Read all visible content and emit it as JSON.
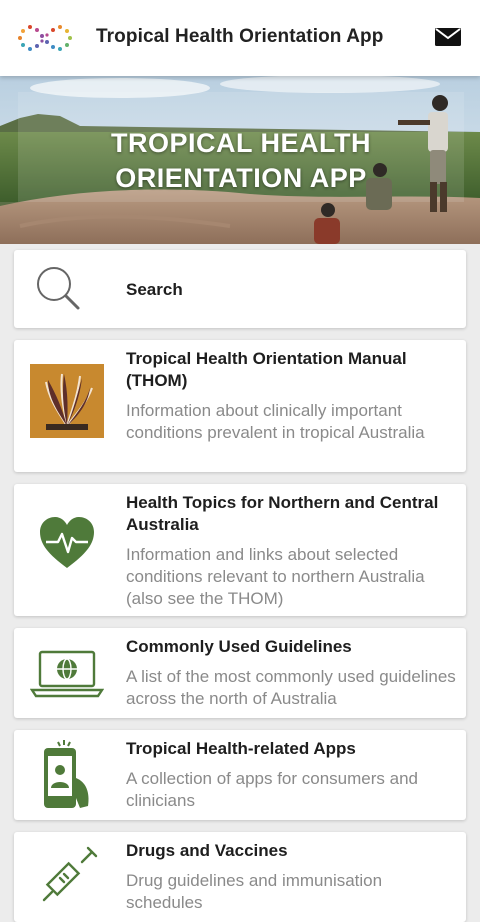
{
  "appbar": {
    "title": "Tropical Health Orientation App",
    "logo_icon": "infinity-dots-logo",
    "mail_icon": "mail-icon"
  },
  "hero": {
    "line1": "TROPICAL HEALTH",
    "line2": "ORIENTATION APP"
  },
  "search": {
    "label": "Search",
    "icon": "search-icon"
  },
  "menu": [
    {
      "icon": "thom-artwork-icon",
      "title": "Tropical Health Orientation Manual (THOM)",
      "description": "Information about clinically important conditions prevalent in tropical Australia"
    },
    {
      "icon": "heart-pulse-icon",
      "title": "Health Topics for Northern and Central Australia",
      "description": "Information and links about selected conditions relevant to northern Australia (also see the THOM)"
    },
    {
      "icon": "laptop-globe-icon",
      "title": "Commonly Used Guidelines",
      "description": "A list of the most commonly used guidelines across the north of Australia"
    },
    {
      "icon": "phone-user-icon",
      "title": "Tropical Health-related Apps",
      "description": "A collection of apps for consumers and clinicians"
    },
    {
      "icon": "syringe-icon",
      "title": "Drugs and Vaccines",
      "description": "Drug guidelines and immunisation schedules"
    }
  ],
  "colors": {
    "accent_green": "#4f7a3a",
    "background": "#ececec"
  }
}
